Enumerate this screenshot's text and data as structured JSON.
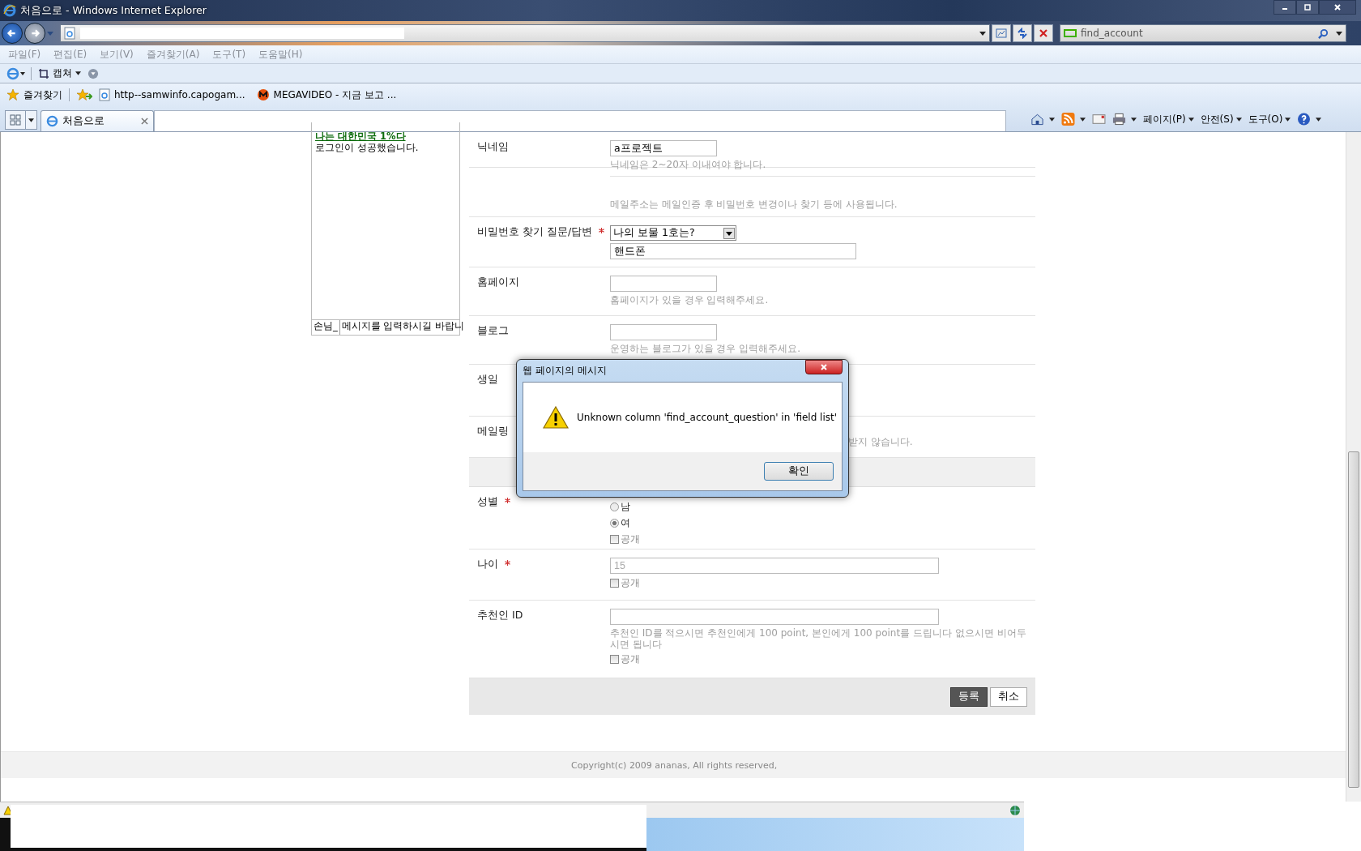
{
  "window": {
    "title": "처음으로 - Windows Internet Explorer"
  },
  "address_bar": {
    "search_value": "find_account"
  },
  "menu_bar": [
    "파일(F)",
    "편집(E)",
    "보기(V)",
    "즐겨찾기(A)",
    "도구(T)",
    "도움말(H)"
  ],
  "command_bar": {
    "capture_label": "캡쳐"
  },
  "favorites_bar": {
    "label": "즐겨찾기",
    "links": [
      {
        "label": "http--samwinfo.capogam...",
        "kind": "page"
      },
      {
        "label": "MEGAVIDEO - 지금 보고 ...",
        "kind": "site"
      }
    ]
  },
  "tabs": [
    {
      "label": "처음으로",
      "selected": true
    }
  ],
  "tab_toolbar": [
    "페이지(P)",
    "안전(S)",
    "도구(O)"
  ],
  "chat": {
    "messages": [
      {
        "text": "나는 대한민국 1%다",
        "kind": "highlight"
      },
      {
        "text": "로그인이 성공했습니다.",
        "kind": "plain"
      }
    ],
    "name_value": "손님_",
    "message_value": "메시지를 입력하시길 바랍니"
  },
  "form": {
    "rows": [
      {
        "kind": "input",
        "label": "닉네임",
        "required": false,
        "value": "a프로젝트",
        "hint": "닉네임은 2~20자 이내여야 합니다."
      },
      {
        "kind": "note",
        "hint": "메일주소는 메일인증 후 비밀번호 변경이나 찾기 등에 사용됩니다."
      },
      {
        "kind": "question",
        "label": "비밀번호 찾기 질문/답변",
        "required": true,
        "value": "나의 보물 1호는?",
        "answer": "핸드폰"
      },
      {
        "kind": "input",
        "label": "홈페이지",
        "required": false,
        "value": "",
        "hint": "홈페이지가 있을 경우 입력해주세요."
      },
      {
        "kind": "input",
        "label": "블로그",
        "required": false,
        "value": "",
        "hint": "운영하는 블로그가 있을 경우 입력해주세요."
      },
      {
        "kind": "blank",
        "label": "생일",
        "required": false
      },
      {
        "kind": "tail",
        "label": "메일링",
        "required": false,
        "hint": "받지 않습니다."
      },
      {
        "kind": "section"
      },
      {
        "kind": "radio",
        "label": "성별",
        "required": true,
        "options": [
          {
            "label": "남",
            "selected": false
          },
          {
            "label": "여",
            "selected": true
          }
        ],
        "public": {
          "label": "공개",
          "checked": false
        }
      },
      {
        "kind": "wide",
        "label": "나이",
        "required": true,
        "placeholder": "15",
        "public": {
          "label": "공개",
          "checked": false
        }
      },
      {
        "kind": "wide",
        "label": "추천인 ID",
        "required": false,
        "placeholder": "",
        "hint": "추천인 ID를 적으시면 추천인에게 100 point, 본인에게 100 point를 드립니다 없으시면 비어두시면 됩니다",
        "public": {
          "label": "공개",
          "checked": false
        }
      }
    ],
    "buttons": [
      {
        "label": "등록",
        "kind": "primary"
      },
      {
        "label": "취소",
        "kind": "default"
      }
    ]
  },
  "footer": "Copyright(c) 2009 ananas, All rights reserved,",
  "dialog": {
    "title": "웹 페이지의 메시지",
    "message": "Unknown column 'find_account_question' in 'field list'",
    "button": "확인"
  }
}
